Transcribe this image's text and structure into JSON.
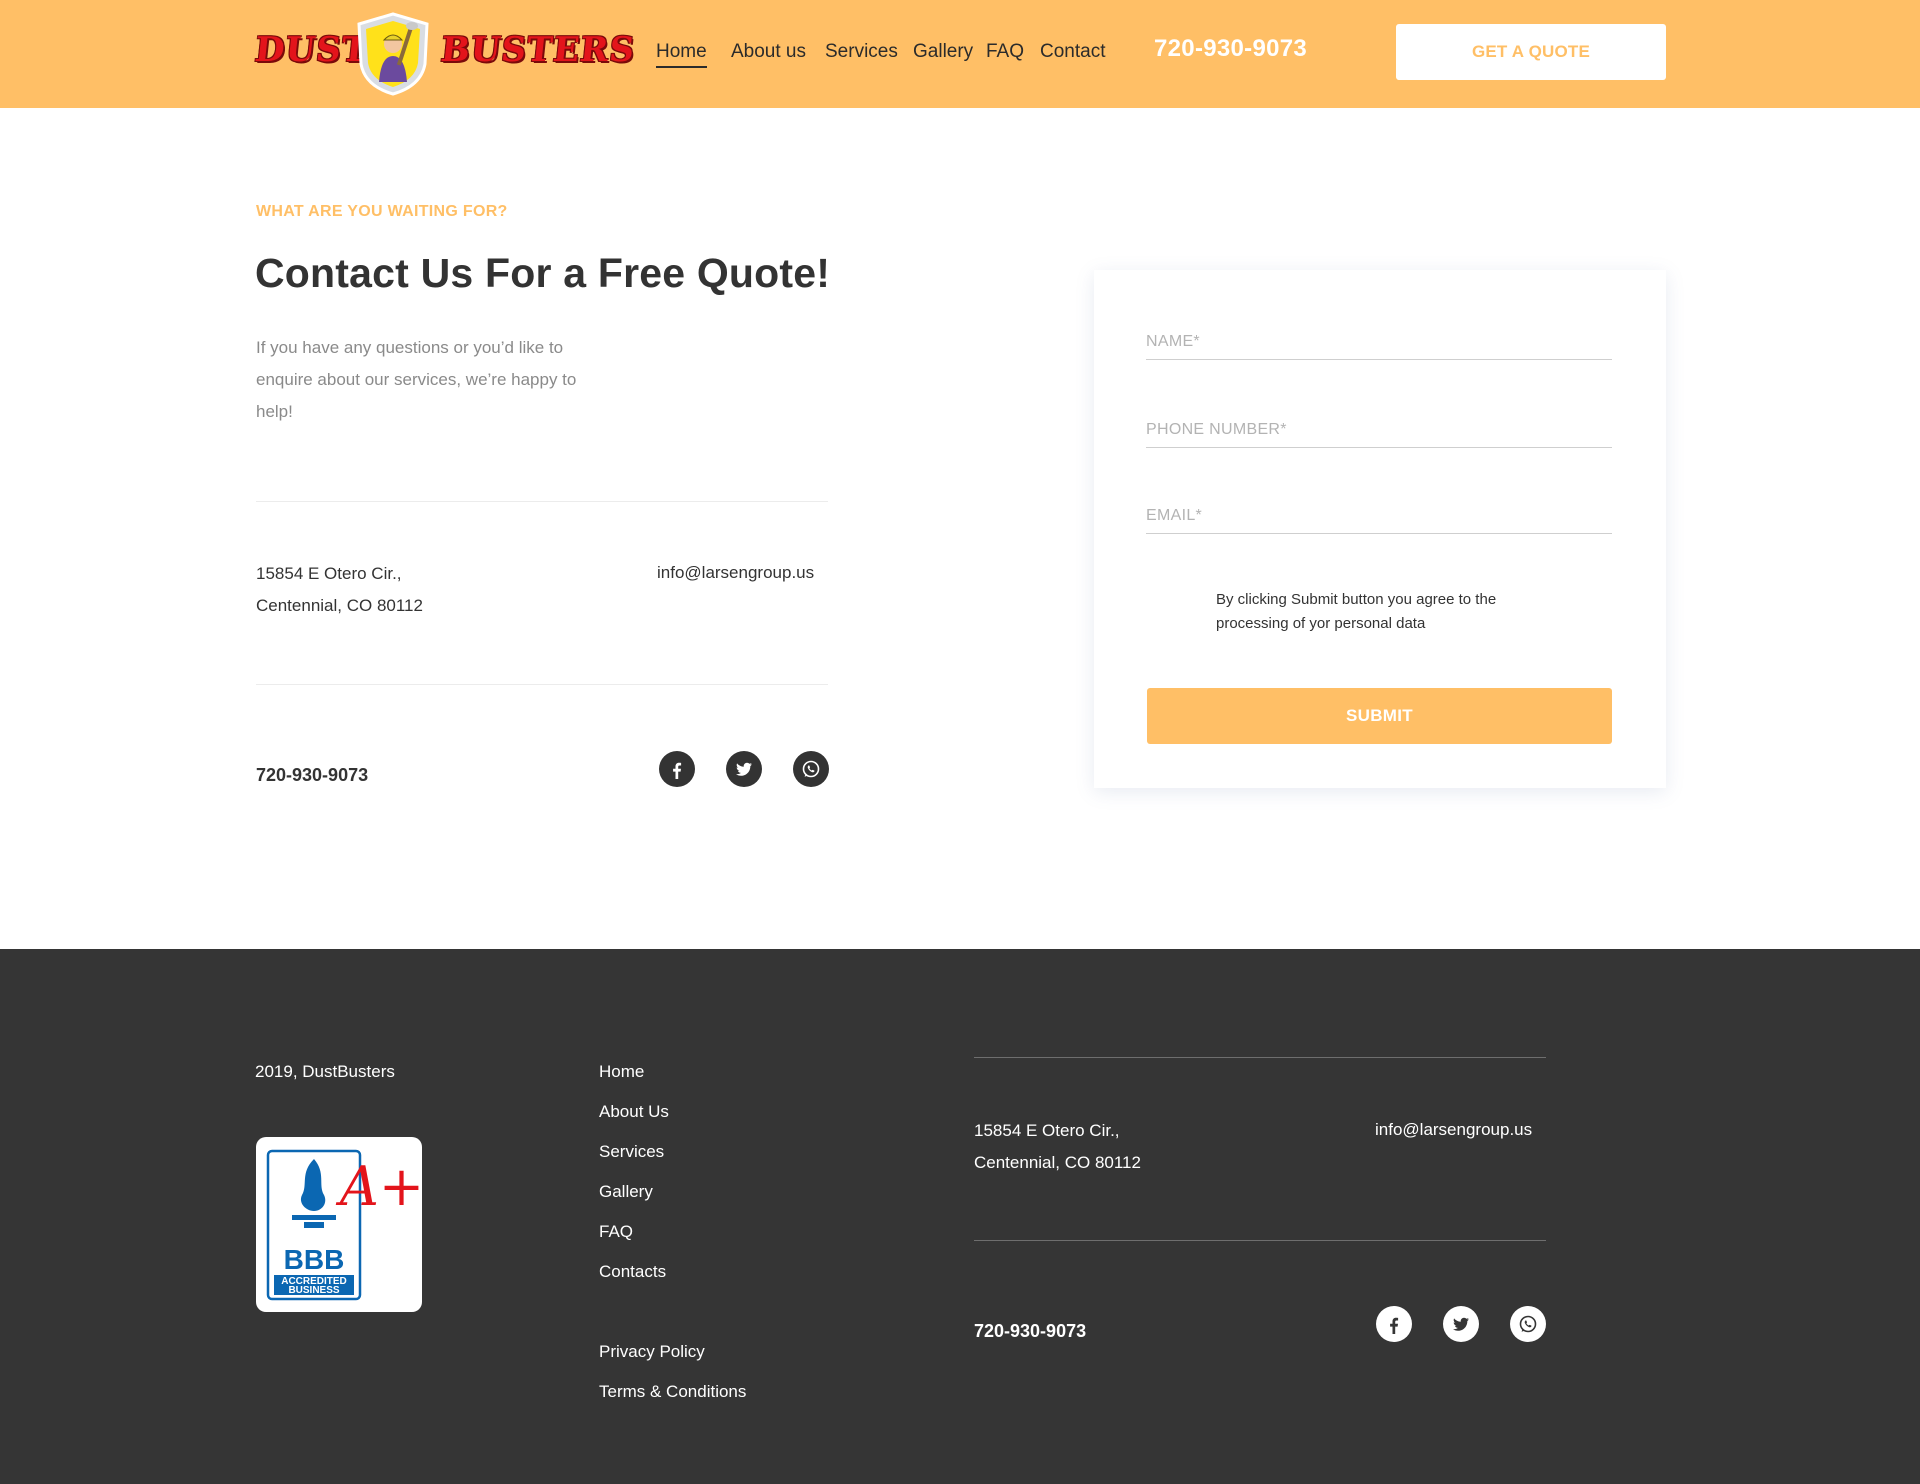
{
  "brand": {
    "name_left": "DUST",
    "name_right": "BUSTERS",
    "colors": {
      "accent": "#ffbf66",
      "dark": "#353535",
      "text": "#333333",
      "logo_red": "#e3141b"
    }
  },
  "header": {
    "nav": [
      "Home",
      "About us",
      "Services",
      "Gallery",
      "FAQ",
      "Contact"
    ],
    "active_nav": "Home",
    "phone": "720-930-9073",
    "cta_label": "GET A QUOTE"
  },
  "contact": {
    "eyebrow": "WHAT ARE YOU WAITING FOR?",
    "title": "Contact Us For a Free Quote!",
    "intro": "If you have any questions or you’d like to enquire about our services,  we’re happy to help!",
    "address_line1": "15854 E Otero Cir.,",
    "address_line2": "Centennial, CO 80112",
    "email": "info@larsengroup.us",
    "phone": "720-930-9073",
    "social": [
      "facebook-icon",
      "twitter-icon",
      "whatsapp-icon"
    ]
  },
  "form": {
    "name_placeholder": "NAME*",
    "phone_placeholder": "PHONE NUMBER*",
    "email_placeholder": "EMAIL*",
    "name_value": "",
    "phone_value": "",
    "email_value": "",
    "consent": "By clicking Submit button you agree to the processing of yor personal data",
    "submit_label": "SUBMIT"
  },
  "footer": {
    "copyright": "2019, DustBusters",
    "bbb_text": "BBB",
    "bbb_caption_1": "ACCREDITED",
    "bbb_caption_2": "BUSINESS",
    "bbb_rating": "A+",
    "links": [
      "Home",
      "About Us",
      "Services",
      "Gallery",
      "FAQ",
      "Contacts"
    ],
    "legal": [
      "Privacy Policy",
      "Terms & Conditions"
    ],
    "address_line1": "15854 E Otero Cir.,",
    "address_line2": "Centennial, CO 80112",
    "email": "info@larsengroup.us",
    "phone": "720-930-9073"
  }
}
